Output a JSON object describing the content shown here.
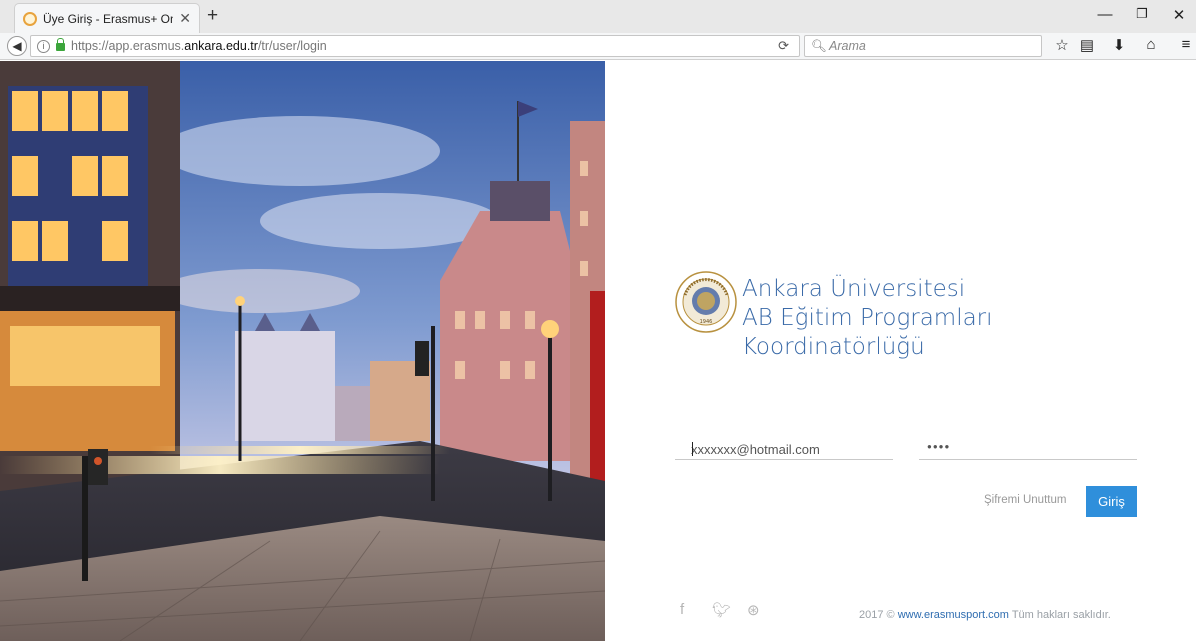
{
  "browser": {
    "tab_title": "Üye Giriş - Erasmus+ Onli...",
    "new_tab": "+",
    "tab_close": "✕",
    "url_scheme": "https://app.erasmus.",
    "url_host": "ankara.edu.tr",
    "url_path": "/tr/user/login",
    "search_placeholder": "Arama"
  },
  "brand": {
    "line1": "Ankara Üniversitesi",
    "line2": "AB Eğitim Programları",
    "line3": "Koordinatörlüğü",
    "seal_text": "ANKARA ÜNİVERSİTESİ 1946"
  },
  "form": {
    "email_value": "xxxxxxx@hotmail.com",
    "password_value": "●●●●",
    "forgot_label": "Şifremi Unuttum",
    "login_label": "Giriş"
  },
  "footer": {
    "copyright_prefix": "2017 © ",
    "link": "www.erasmusport.com",
    "suffix": " Tüm hakları saklıdır."
  },
  "colors": {
    "accent": "#2f8fdb",
    "brand_text": "#3a6aa8"
  }
}
